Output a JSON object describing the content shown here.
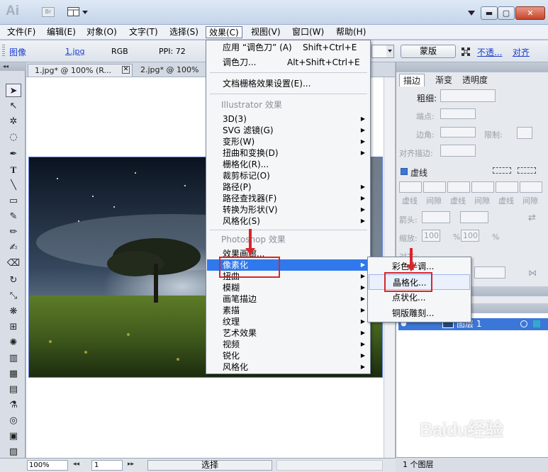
{
  "title_bar": {
    "logo": "Ai",
    "bridge": "Br",
    "minimize": "▬",
    "restore": "▢",
    "close": "✕"
  },
  "menubar": {
    "items": [
      "文件(F)",
      "编辑(E)",
      "对象(O)",
      "文字(T)",
      "选择(S)",
      "效果(C)",
      "视图(V)",
      "窗口(W)",
      "帮助(H)"
    ]
  },
  "controlbar": {
    "object_type": "图像",
    "file_link": "1.jpg",
    "color_mode": "RGB",
    "ppi": "PPI: 72",
    "mask_button": "蒙版",
    "opacity_link": "不透...",
    "align_link": "对齐"
  },
  "doc_tabs": [
    {
      "label": "1.jpg* @ 100% (R..."
    },
    {
      "label": "2.jpg* @ 100%"
    }
  ],
  "effect_menu": {
    "apply": {
      "label": "应用 “调色刀” (A)",
      "shortcut": "Shift+Ctrl+E"
    },
    "palette_knife": {
      "label": "调色刀...",
      "shortcut": "Alt+Shift+Ctrl+E"
    },
    "doc_raster_settings": "文档栅格效果设置(E)...",
    "illustrator_header": "Illustrator 效果",
    "illustrator_items": [
      "3D(3)",
      "SVG 滤镜(G)",
      "变形(W)",
      "扭曲和变换(D)",
      "栅格化(R)...",
      "裁剪标记(O)",
      "路径(P)",
      "路径查找器(F)",
      "转换为形状(V)",
      "风格化(S)"
    ],
    "photoshop_header": "Photoshop 效果",
    "photoshop_items": [
      "效果画廊...",
      "像素化",
      "扭曲",
      "模糊",
      "画笔描边",
      "素描",
      "纹理",
      "艺术效果",
      "视频",
      "锐化",
      "风格化"
    ]
  },
  "pixelate_submenu": {
    "items": [
      "彩色半调...",
      "晶格化...",
      "点状化...",
      "铜版雕刻..."
    ]
  },
  "stroke_panel": {
    "tabs": [
      "描边",
      "渐变",
      "透明度"
    ],
    "weight_label": "粗细:",
    "cap_label": "端点:",
    "corner_label": "边角:",
    "limit_label": "限制:",
    "align_label": "对齐描边:",
    "dashed_label": "虚线",
    "dash_labels": [
      "虚线",
      "间隙",
      "虚线",
      "间隙",
      "虚线",
      "间隙"
    ],
    "arrow_label": "箭头:",
    "scale_label": "缩放:",
    "scale_value_1": "100",
    "scale_value_2": "100",
    "percent": "%",
    "align_label_2": "对齐:"
  },
  "layers_panel": {
    "layer_name": "图层 1",
    "count": "1 个图层"
  },
  "statusbar": {
    "zoom": "100%",
    "page": "1",
    "tool": "选择"
  },
  "watermark": {
    "brand": "Baidu经验",
    "url": "jingyan.baidu.com"
  }
}
